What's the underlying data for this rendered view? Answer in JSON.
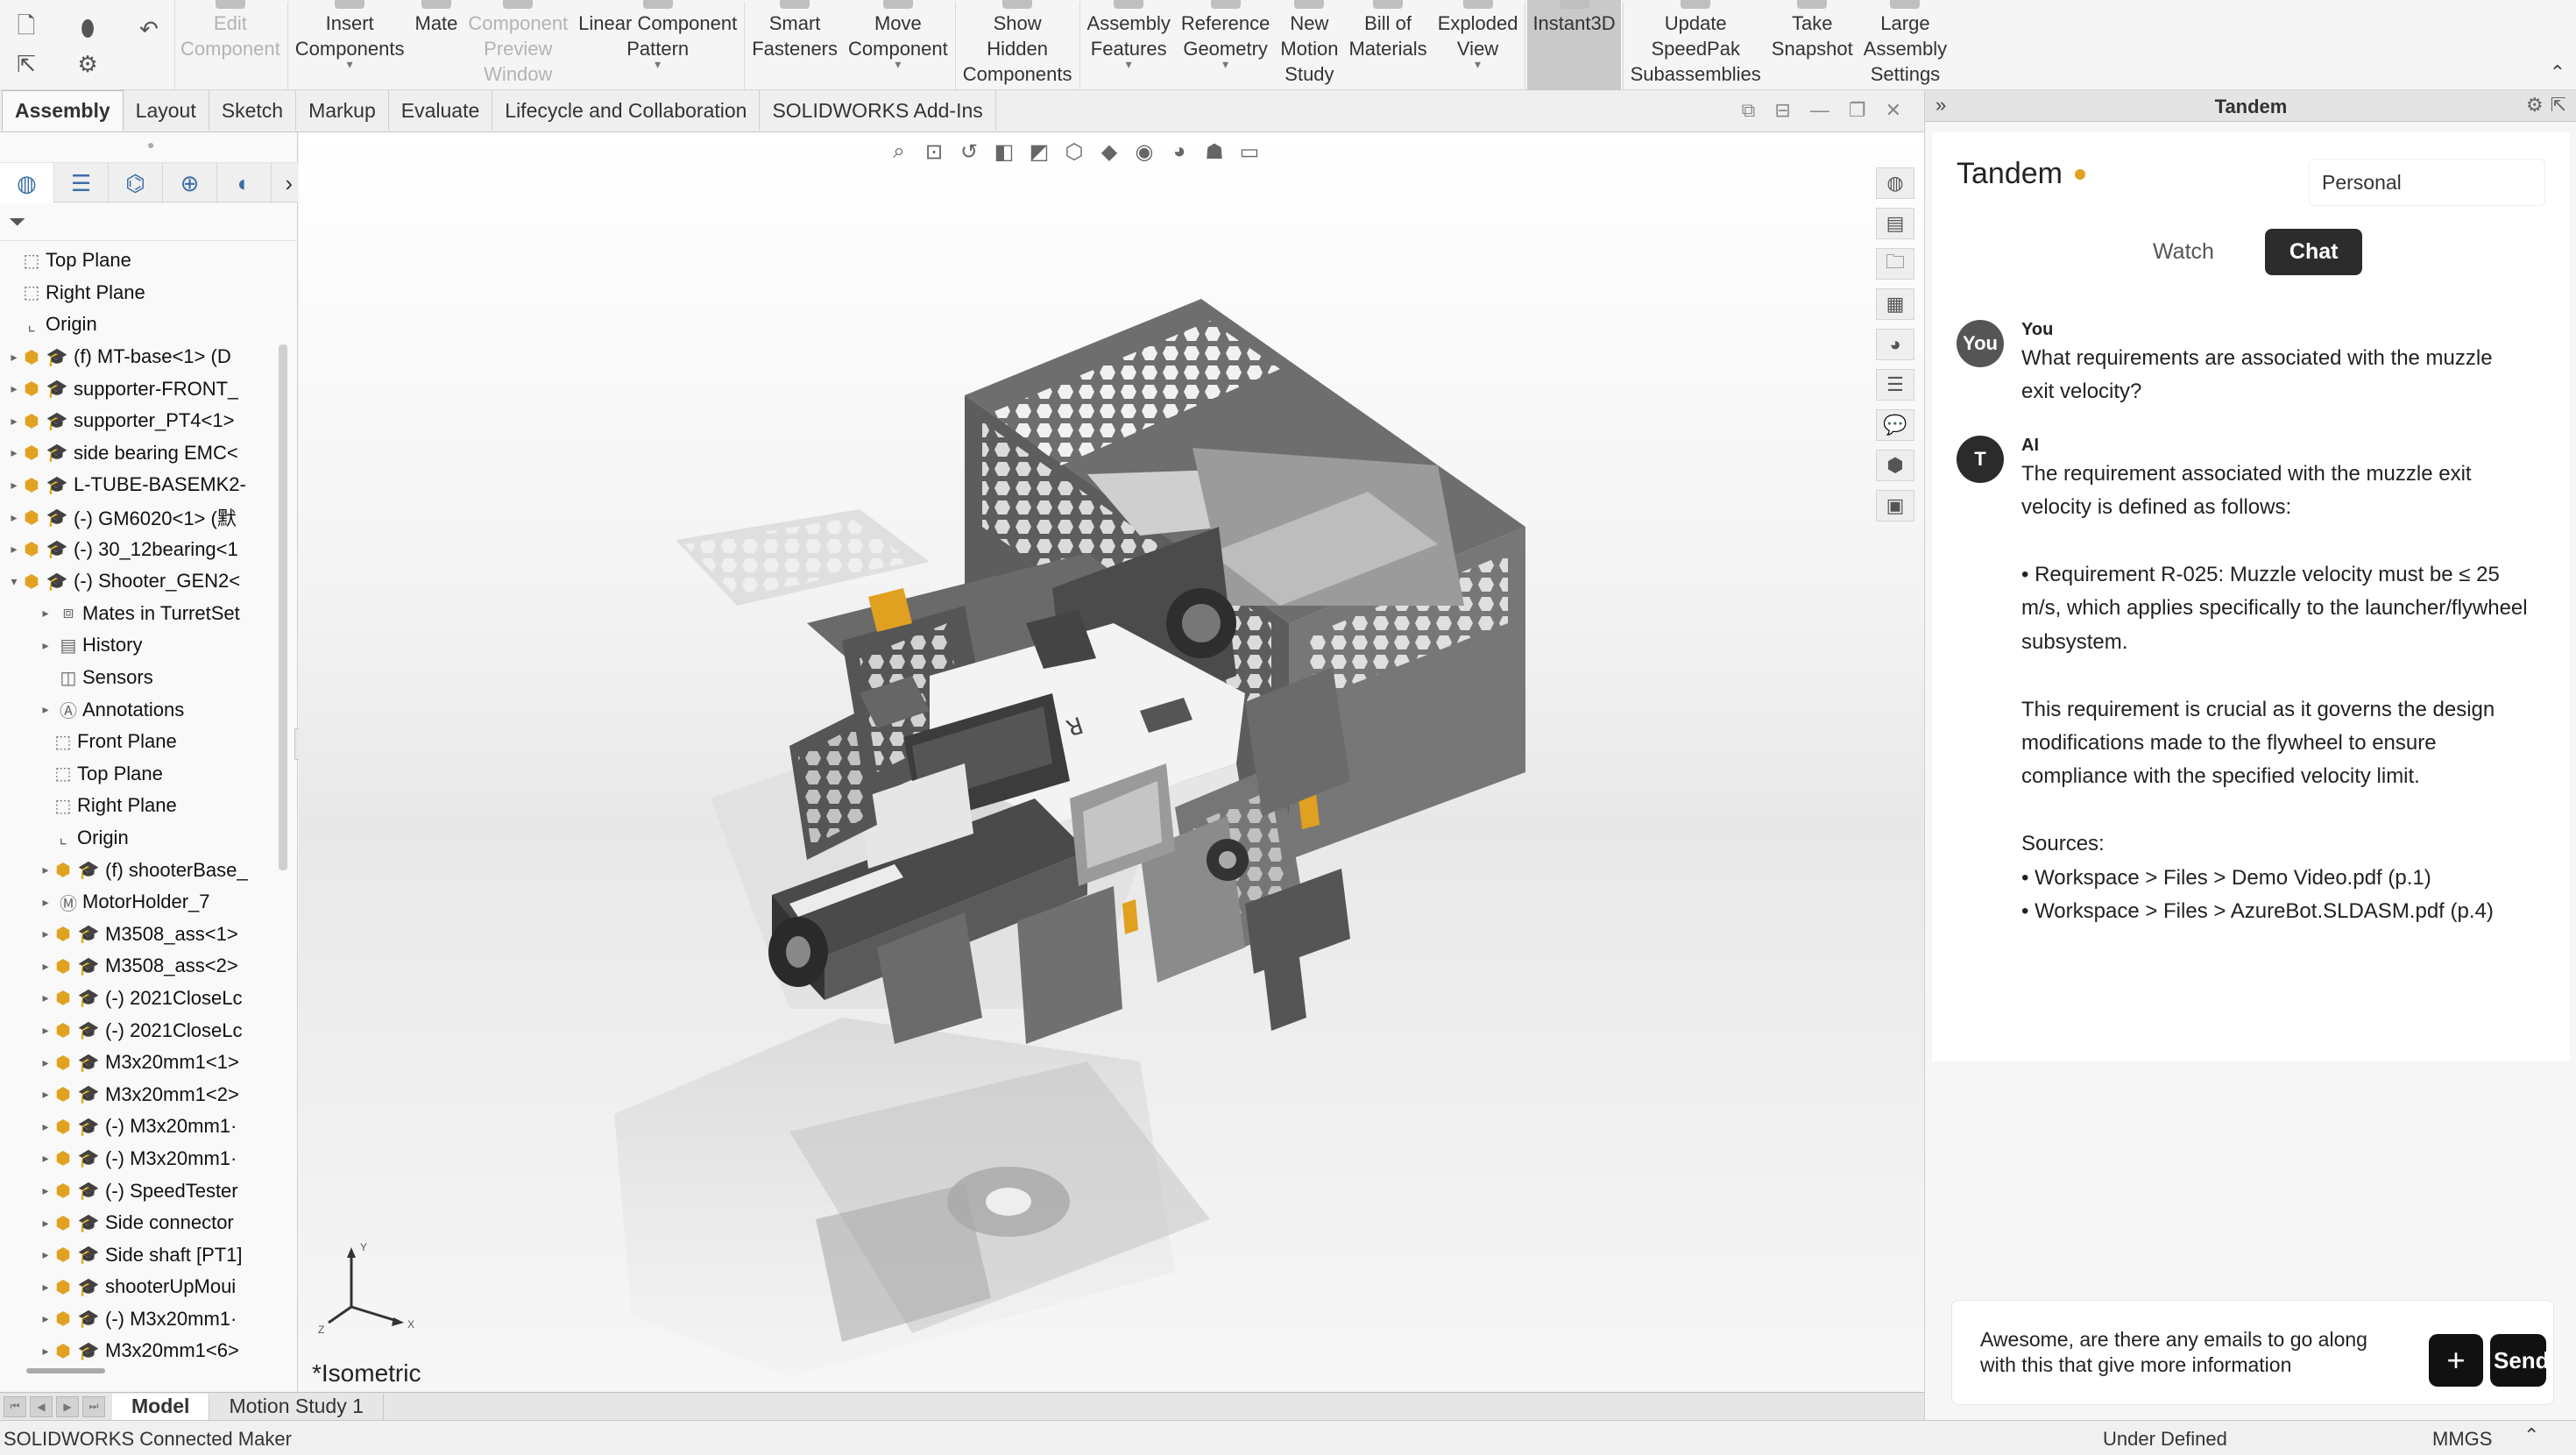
{
  "ribbon": {
    "buttons": [
      {
        "label": "Edit\nComponent",
        "disabled": true
      },
      {
        "label": "Insert\nComponents",
        "dropdown": true
      },
      {
        "label": "Mate"
      },
      {
        "label": "Component\nPreview\nWindow",
        "disabled": true
      },
      {
        "label": "Linear Component\nPattern",
        "dropdown": true
      },
      {
        "label": "Smart\nFasteners"
      },
      {
        "label": "Move\nComponent",
        "dropdown": true
      },
      {
        "label": "Show\nHidden\nComponents"
      },
      {
        "label": "Assembly\nFeatures",
        "dropdown": true
      },
      {
        "label": "Reference\nGeometry",
        "dropdown": true
      },
      {
        "label": "New\nMotion\nStudy"
      },
      {
        "label": "Bill of\nMaterials"
      },
      {
        "label": "Exploded\nView",
        "dropdown": true
      },
      {
        "label": "Instant3D",
        "active": true
      },
      {
        "label": "Update\nSpeedPak\nSubassemblies"
      },
      {
        "label": "Take\nSnapshot"
      },
      {
        "label": "Large\nAssembly\nSettings"
      }
    ],
    "collapse_glyph": "⌃"
  },
  "command_tabs": [
    "Assembly",
    "Layout",
    "Sketch",
    "Markup",
    "Evaluate",
    "Lifecycle and Collaboration",
    "SOLIDWORKS Add-Ins"
  ],
  "active_command_tab": "Assembly",
  "feature_tree": {
    "items": [
      {
        "label": "Top Plane",
        "type": "plane",
        "depth": 0,
        "expand": ""
      },
      {
        "label": "Right Plane",
        "type": "plane",
        "depth": 0,
        "expand": ""
      },
      {
        "label": "Origin",
        "type": "origin",
        "depth": 0,
        "expand": ""
      },
      {
        "label": "(f) MT-base<1> (D",
        "type": "part",
        "depth": 0,
        "expand": "▸"
      },
      {
        "label": "supporter-FRONT_",
        "type": "part",
        "depth": 0,
        "expand": "▸"
      },
      {
        "label": "supporter_PT4<1>",
        "type": "part",
        "depth": 0,
        "expand": "▸"
      },
      {
        "label": "side bearing EMC<",
        "type": "part",
        "depth": 0,
        "expand": "▸"
      },
      {
        "label": "L-TUBE-BASEMK2-",
        "type": "part",
        "depth": 0,
        "expand": "▸"
      },
      {
        "label": "(-) GM6020<1> (默",
        "type": "part",
        "depth": 0,
        "expand": "▸"
      },
      {
        "label": "(-) 30_12bearing<1",
        "type": "part",
        "depth": 0,
        "expand": "▸"
      },
      {
        "label": "(-) Shooter_GEN2<",
        "type": "asm",
        "depth": 0,
        "expand": "▾"
      },
      {
        "label": "Mates in TurretSet",
        "type": "mates",
        "depth": 1,
        "expand": "▸"
      },
      {
        "label": "History",
        "type": "history",
        "depth": 1,
        "expand": "▸"
      },
      {
        "label": "Sensors",
        "type": "sensors",
        "depth": 1,
        "expand": ""
      },
      {
        "label": "Annotations",
        "type": "annotations",
        "depth": 1,
        "expand": "▸"
      },
      {
        "label": "Front Plane",
        "type": "plane",
        "depth": 1,
        "expand": ""
      },
      {
        "label": "Top Plane",
        "type": "plane",
        "depth": 1,
        "expand": ""
      },
      {
        "label": "Right Plane",
        "type": "plane",
        "depth": 1,
        "expand": ""
      },
      {
        "label": "Origin",
        "type": "origin",
        "depth": 1,
        "expand": ""
      },
      {
        "label": "(f) shooterBase_",
        "type": "part",
        "depth": 1,
        "expand": "▸"
      },
      {
        "label": "MotorHolder_7",
        "type": "motor",
        "depth": 1,
        "expand": "▸"
      },
      {
        "label": "M3508_ass<1>",
        "type": "part",
        "depth": 1,
        "expand": "▸"
      },
      {
        "label": "M3508_ass<2>",
        "type": "part",
        "depth": 1,
        "expand": "▸"
      },
      {
        "label": "(-) 2021CloseLc",
        "type": "part",
        "depth": 1,
        "expand": "▸"
      },
      {
        "label": "(-) 2021CloseLc",
        "type": "part",
        "depth": 1,
        "expand": "▸"
      },
      {
        "label": "M3x20mm1<1>",
        "type": "part",
        "depth": 1,
        "expand": "▸"
      },
      {
        "label": "M3x20mm1<2>",
        "type": "part",
        "depth": 1,
        "expand": "▸"
      },
      {
        "label": "(-) M3x20mm1·",
        "type": "part",
        "depth": 1,
        "expand": "▸"
      },
      {
        "label": "(-) M3x20mm1·",
        "type": "part",
        "depth": 1,
        "expand": "▸"
      },
      {
        "label": "(-) SpeedTester",
        "type": "part",
        "depth": 1,
        "expand": "▸"
      },
      {
        "label": "Side connector",
        "type": "part",
        "depth": 1,
        "expand": "▸"
      },
      {
        "label": "Side shaft [PT1]",
        "type": "part",
        "depth": 1,
        "expand": "▸"
      },
      {
        "label": "shooterUpMoui",
        "type": "part",
        "depth": 1,
        "expand": "▸"
      },
      {
        "label": "(-) M3x20mm1·",
        "type": "part",
        "depth": 1,
        "expand": "▸"
      },
      {
        "label": "M3x20mm1<6>",
        "type": "part",
        "depth": 1,
        "expand": "▸"
      }
    ]
  },
  "viewport": {
    "view_label": "*Isometric",
    "triad_axes": [
      "Y",
      "X",
      "Z"
    ]
  },
  "bottom_tabs": [
    "Model",
    "Motion Study 1"
  ],
  "active_bottom_tab": "Model",
  "status_bar": {
    "left": "SOLIDWORKS Connected Maker",
    "definition": "Under Defined",
    "units": "MMGS",
    "arrow": "⌃"
  },
  "tandem": {
    "panel_title": "Tandem",
    "collapse_glyph": "»",
    "brand": "Tandem",
    "workspace": "Personal",
    "tabs": [
      "Watch",
      "Chat"
    ],
    "active_tab": "Chat",
    "messages": [
      {
        "avatar": "You",
        "author": "You",
        "text": "What requirements are associated with the muzzle\nexit velocity?"
      },
      {
        "avatar": "T",
        "author": "AI",
        "text": "The requirement associated with the muzzle exit\nvelocity is defined as follows:\n\n• Requirement R-025: Muzzle velocity must be ≤ 25\nm/s, which applies specifically to the launcher/flywheel\nsubsystem.\n\nThis requirement is crucial as it governs the design\nmodifications made to the flywheel to ensure\ncompliance with the specified velocity limit.\n\nSources:\n• Workspace > Files > Demo Video.pdf (p.1)\n• Workspace > Files > AzureBot.SLDASM.pdf (p.4)"
      }
    ],
    "composer_text": "Awesome, are there any emails to go along\nwith this that give more information",
    "plus_label": "+",
    "send_label": "Send"
  },
  "colors": {
    "accent_dot": "#e0a020",
    "chat_tab_active": "#2c2c2c",
    "part_icon": "#e2a221",
    "tree_icon_blue": "#3d6db0"
  }
}
